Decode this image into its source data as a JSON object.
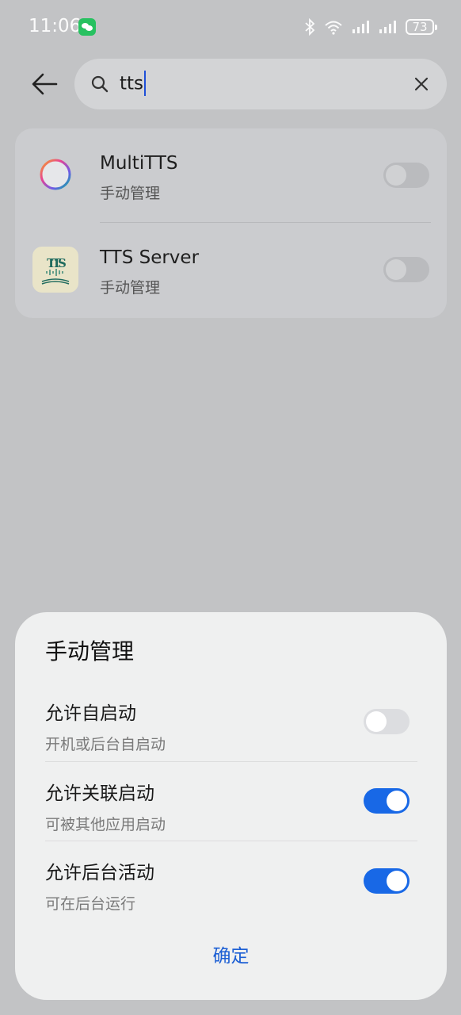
{
  "status_bar": {
    "time": "11:06",
    "battery": "73",
    "icons": [
      "wechat-icon",
      "bluetooth-icon",
      "wifi-icon",
      "signal-icon",
      "signal-icon",
      "battery-icon"
    ]
  },
  "search": {
    "query": "tts",
    "icons": [
      "back-arrow-icon",
      "search-icon",
      "clear-icon"
    ]
  },
  "results": [
    {
      "name": "MultiTTS",
      "subtitle": "手动管理",
      "toggle": "off"
    },
    {
      "name": "TTS Server",
      "subtitle": "手动管理",
      "toggle": "off"
    }
  ],
  "sheet": {
    "title": "手动管理",
    "options": [
      {
        "label": "允许自启动",
        "subtitle": "开机或后台自启动",
        "state": "off"
      },
      {
        "label": "允许关联启动",
        "subtitle": "可被其他应用启动",
        "state": "on"
      },
      {
        "label": "允许后台活动",
        "subtitle": "可在后台运行",
        "state": "on"
      }
    ],
    "confirm_label": "确定"
  },
  "colors": {
    "accent": "#1868e6",
    "confirm_text": "#1c5fd4",
    "wechat": "#27c160"
  }
}
